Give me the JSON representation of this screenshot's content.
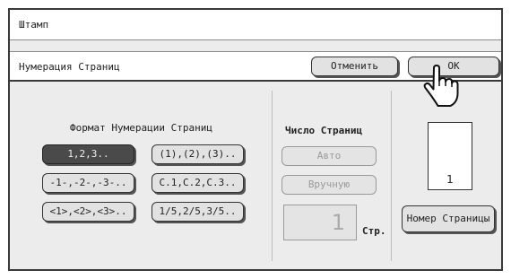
{
  "window": {
    "title": "Штамп"
  },
  "subbar": {
    "label": "Нумерация Страниц",
    "cancel_label": "Отменить",
    "ok_label": "OK"
  },
  "format": {
    "heading": "Формат Нумерации Страниц",
    "options": [
      {
        "label": "1,2,3..",
        "selected": true
      },
      {
        "label": "(1),(2),(3)..",
        "selected": false
      },
      {
        "label": "-1-,-2-,-3-..",
        "selected": false
      },
      {
        "label": "C.1,C.2,C.3..",
        "selected": false
      },
      {
        "label": "<1>,<2>,<3>..",
        "selected": false
      },
      {
        "label": "1/5,2/5,3/5..",
        "selected": false
      }
    ]
  },
  "count": {
    "heading": "Число Страниц",
    "auto_label": "Авто",
    "manual_label": "Вручную",
    "value": "1",
    "unit": "Стр."
  },
  "preview": {
    "page_number": "1",
    "button_label": "Номер Страницы"
  },
  "colors": {
    "selected_fill": "#4a4a4a",
    "panel_bg": "#ececec",
    "disabled_text": "#9a9a9a"
  },
  "icons": {
    "pointer": "hand-pointer-icon"
  }
}
